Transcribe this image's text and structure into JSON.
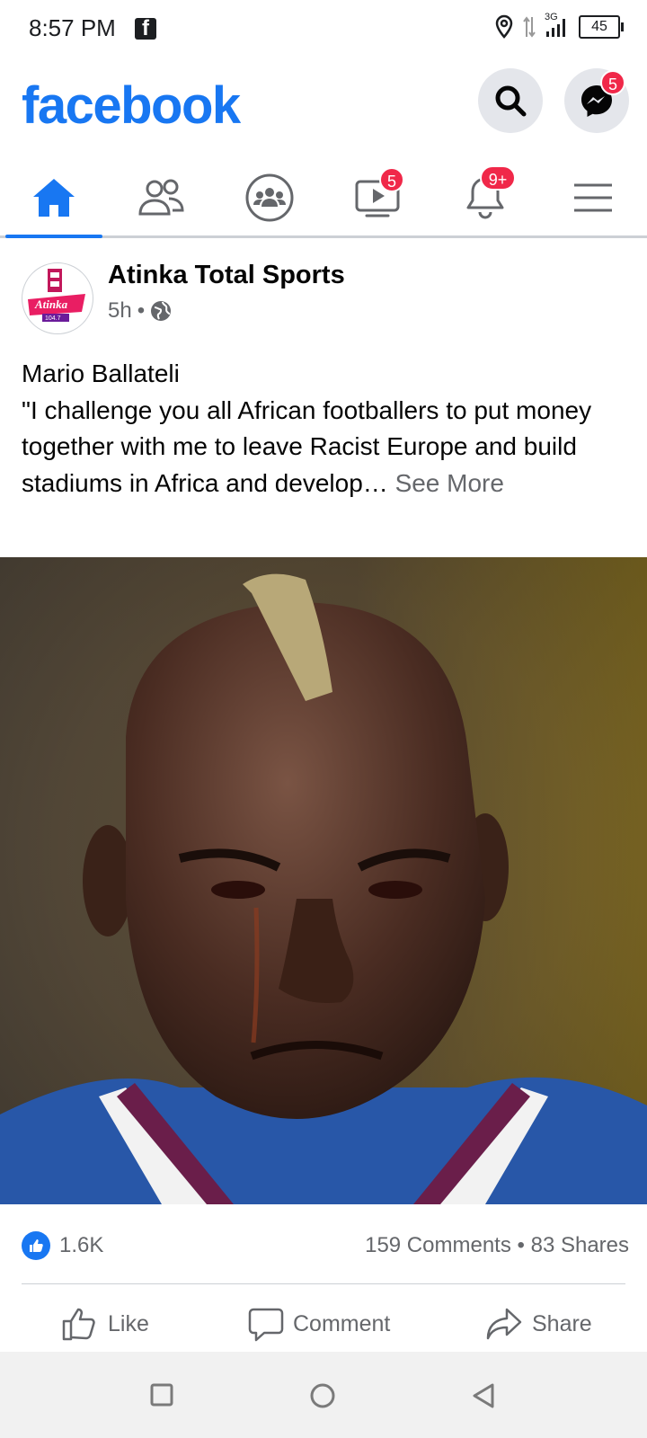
{
  "status_bar": {
    "time": "8:57 PM",
    "network": "3G",
    "battery": "45"
  },
  "header": {
    "logo": "facebook",
    "messenger_badge": "5"
  },
  "nav": {
    "items": [
      {
        "name": "home",
        "icon": "home-icon",
        "active": true,
        "badge": ""
      },
      {
        "name": "friends",
        "icon": "friends-icon",
        "active": false,
        "badge": ""
      },
      {
        "name": "groups",
        "icon": "groups-icon",
        "active": false,
        "badge": ""
      },
      {
        "name": "watch",
        "icon": "watch-icon",
        "active": false,
        "badge": "5"
      },
      {
        "name": "notifications",
        "icon": "bell-icon",
        "active": false,
        "badge": "9+"
      },
      {
        "name": "menu",
        "icon": "menu-icon",
        "active": false,
        "badge": ""
      }
    ]
  },
  "post": {
    "page_name": "Atinka Total Sports",
    "time_ago": "5h",
    "separator": "•",
    "audience_icon": "globe-icon",
    "avatar_text": "Atinka",
    "avatar_sub": "104.7",
    "text_line1": "Mario Ballateli",
    "text_body": "\"I challenge you all African footballers to put money together with me to leave Racist Europe and build stadiums in Africa and develop…",
    "see_more": "See More",
    "likes": "1.6K",
    "comments": "159 Comments",
    "dot": "•",
    "shares": "83 Shares"
  },
  "actions": {
    "like": "Like",
    "comment": "Comment",
    "share": "Share"
  },
  "colors": {
    "brand": "#1877f2",
    "badge": "#f02849",
    "secondary_text": "#65676b"
  }
}
